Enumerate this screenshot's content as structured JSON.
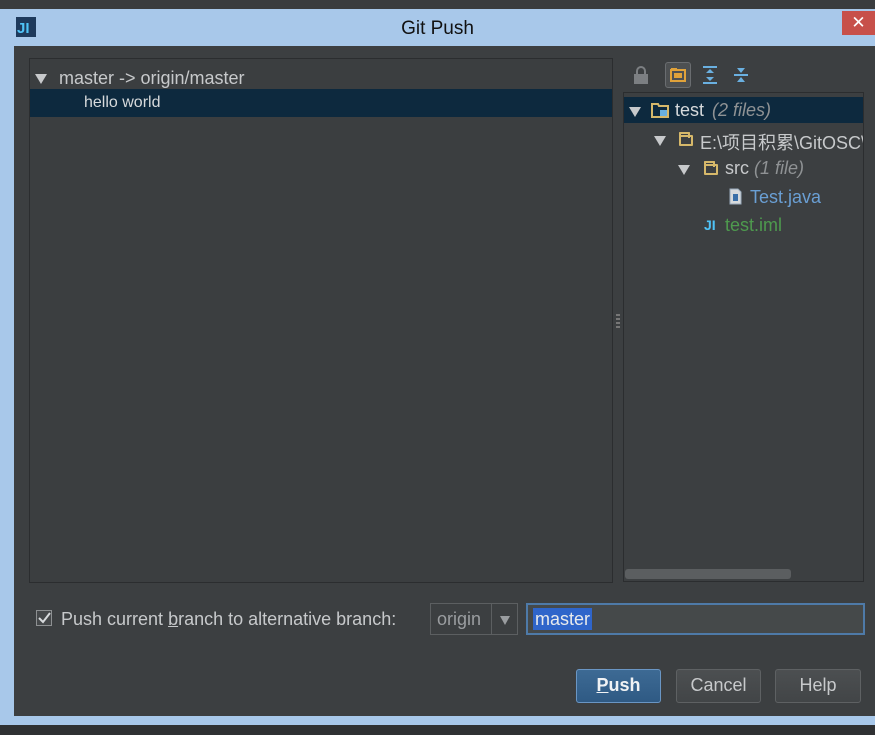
{
  "window": {
    "title": "Git Push",
    "close_glyph": "✕"
  },
  "commits": {
    "branch": "master -> origin/master",
    "items": [
      {
        "message": "hello world"
      }
    ]
  },
  "toolbar": {
    "icons": [
      "lock-icon",
      "group-by-directory-icon",
      "expand-all-icon",
      "collapse-all-icon"
    ]
  },
  "tree": {
    "root": {
      "name": "test",
      "meta": "(2 files)"
    },
    "dir": {
      "name": "E:\\项目积累\\GitOSC\\"
    },
    "src": {
      "name": "src",
      "meta": "(1 file)"
    },
    "file1": {
      "name": "Test.java"
    },
    "file2": {
      "name": "test.iml"
    }
  },
  "options": {
    "alt_branch_pre": "Push current ",
    "alt_branch_mn": "b",
    "alt_branch_post": "ranch to alternative branch:",
    "checked": true,
    "remote": "origin",
    "branch_value": "master"
  },
  "buttons": {
    "push_mn": "P",
    "push_rest": "ush",
    "cancel": "Cancel",
    "help": "Help"
  },
  "colors": {
    "selection": "#0d293e",
    "added_file": "#4e9a4e",
    "modified_file": "#6a9fd4",
    "folder": "#d6b86a"
  }
}
